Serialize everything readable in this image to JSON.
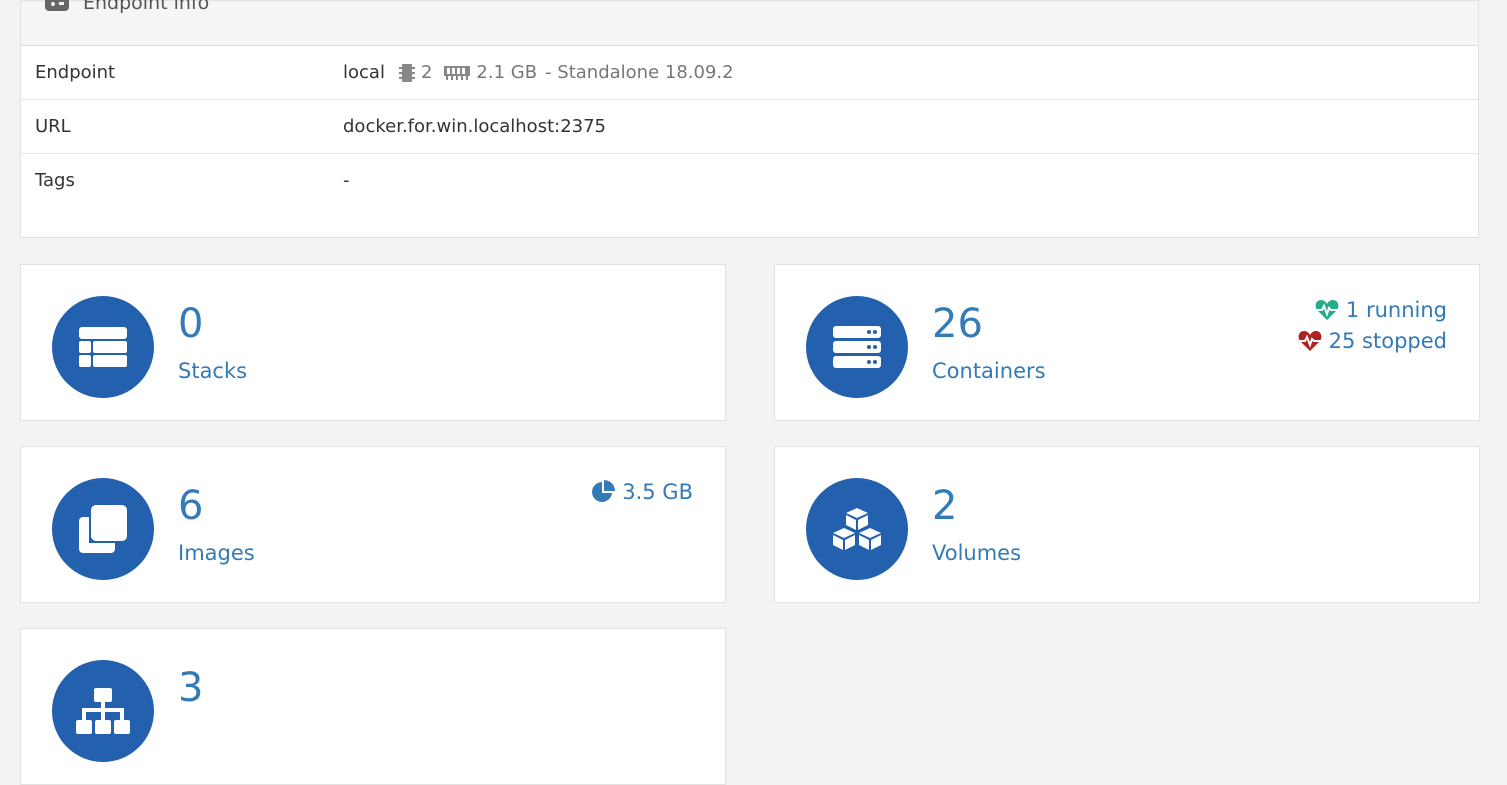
{
  "endpoint_panel": {
    "title": "Endpoint info",
    "rows": {
      "endpoint": {
        "key": "Endpoint",
        "name": "local",
        "cpu": "2",
        "memory": "2.1 GB",
        "mode": "- Standalone 18.09.2"
      },
      "url": {
        "key": "URL",
        "value": "docker.for.win.localhost:2375"
      },
      "tags": {
        "key": "Tags",
        "value": "-"
      }
    }
  },
  "cards": {
    "stacks": {
      "count": "0",
      "label": "Stacks",
      "icon": "table-icon"
    },
    "containers": {
      "count": "26",
      "label": "Containers",
      "icon": "server-icon",
      "running": "1 running",
      "stopped": "25 stopped"
    },
    "images": {
      "count": "6",
      "label": "Images",
      "icon": "clone-icon",
      "size": "3.5 GB"
    },
    "volumes": {
      "count": "2",
      "label": "Volumes",
      "icon": "cubes-icon"
    },
    "networks": {
      "count": "3",
      "icon": "sitemap-icon"
    }
  },
  "colors": {
    "accent": "#337ab7",
    "circle": "#2360ad",
    "running": "#23ae89",
    "stopped": "#ae2323"
  }
}
